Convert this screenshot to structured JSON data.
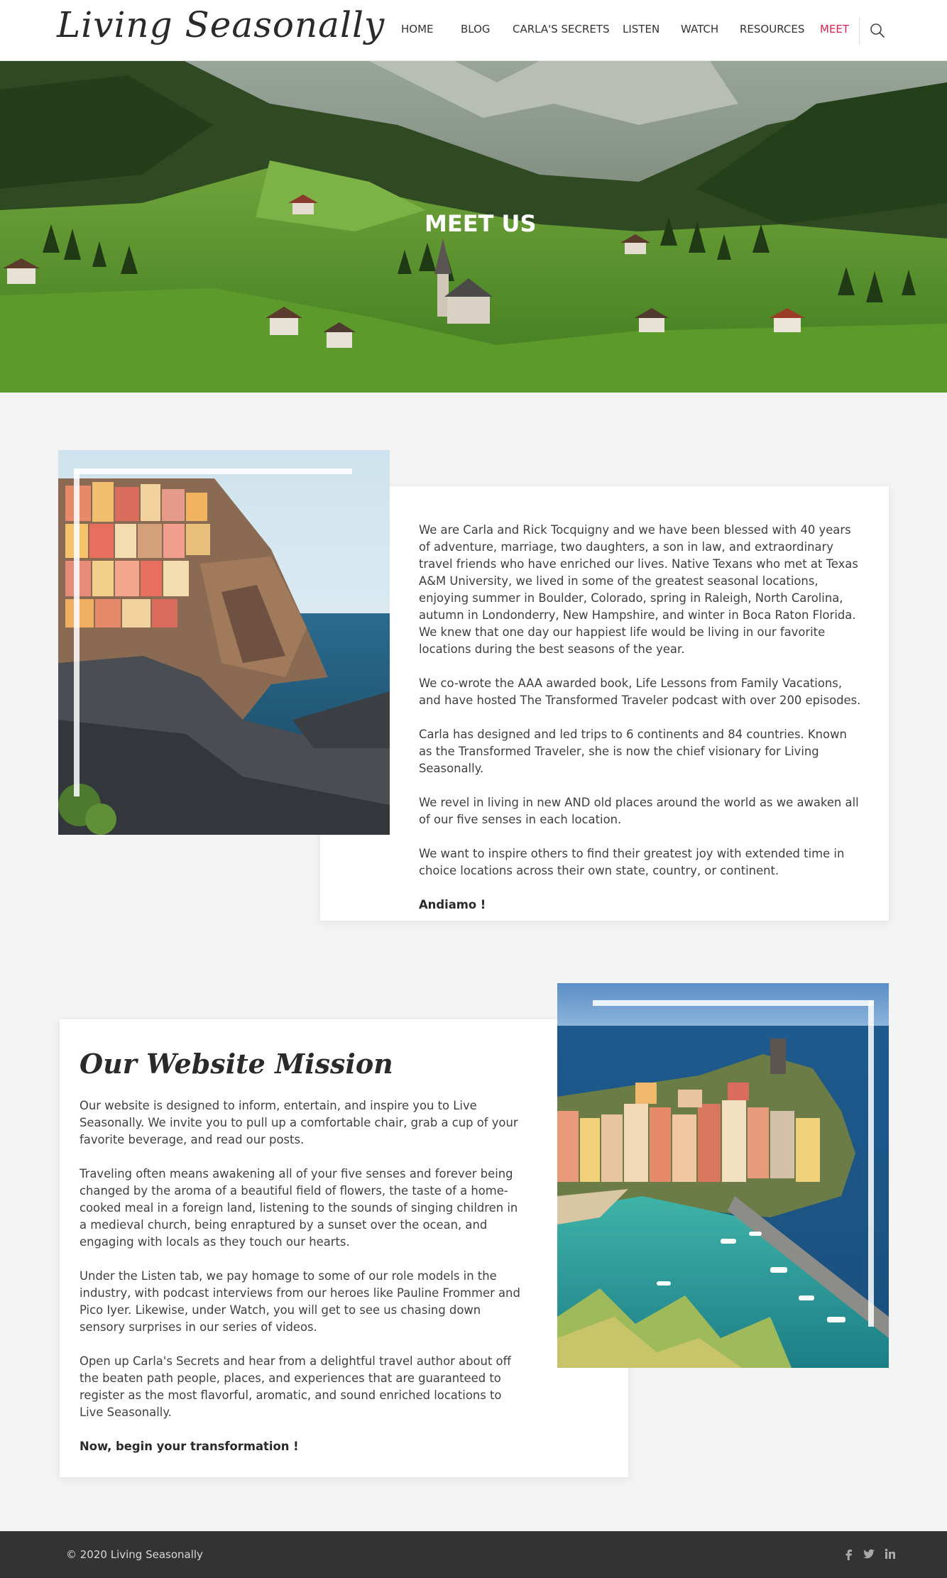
{
  "site": {
    "logo_text": "Living Seasonally"
  },
  "nav": {
    "items": [
      {
        "label": "HOME"
      },
      {
        "label": "BLOG"
      },
      {
        "label": "CARLA'S SECRETS"
      },
      {
        "label": "LISTEN"
      },
      {
        "label": "WATCH"
      },
      {
        "label": "RESOURCES"
      },
      {
        "label": "MEET"
      }
    ],
    "active": "MEET",
    "search_icon": "search-icon"
  },
  "hero": {
    "title": "MEET US"
  },
  "about": {
    "paragraphs": [
      "We are Carla and Rick Tocquigny and we have been blessed with 40 years of adventure, marriage, two daughters, a son in law, and extraordinary travel friends who have enriched our lives. Native Texans who met at Texas A&M University, we lived in some of the greatest seasonal locations, enjoying summer in Boulder, Colorado, spring in Raleigh, North Carolina, autumn in Londonderry, New Hampshire, and winter in Boca Raton Florida. We knew that one day our happiest life would be living in our favorite locations during the best seasons of the year.",
      "We co-wrote the AAA awarded book, Life Lessons from Family Vacations, and have hosted The Transformed Traveler podcast with over 200 episodes.",
      "Carla has designed and led trips to 6 continents and 84 countries. Known as the Transformed Traveler, she is now the chief visionary for Living Seasonally.",
      "We revel in living in new AND old places around the world as we awaken all of our five senses in each location.",
      "We want to inspire others to find their greatest joy with extended time in choice locations across their own state, country, or continent."
    ],
    "closing": "Andiamo !"
  },
  "mission": {
    "title": "Our Website Mission",
    "paragraphs": [
      "Our website is designed to inform, entertain, and inspire you to Live Seasonally. We invite you to pull up a comfortable chair, grab a cup of your favorite beverage, and read our posts.",
      "Traveling often means awakening all of your five senses and forever being changed by the aroma of a beautiful field of flowers, the taste of a home-cooked meal in a foreign land, listening to the sounds of singing children in a medieval church, being enraptured by a sunset over the ocean, and engaging with locals as they touch our hearts.",
      "Under the Listen tab, we pay homage to some of our role models in the industry, with podcast interviews from our heroes like Pauline Frommer and Pico Iyer. Likewise, under Watch, you will get to see us chasing down sensory surprises in our series of videos.",
      "Open up Carla's Secrets and hear from a delightful travel author about off the beaten path people, places, and experiences that are guaranteed to register as the most flavorful, aromatic, and sound enriched locations to Live Seasonally."
    ],
    "closing": "Now, begin your transformation !"
  },
  "footer": {
    "copyright": "© 2020 Living Seasonally",
    "social_icons": [
      "facebook-icon",
      "twitter-icon",
      "linkedin-icon"
    ]
  },
  "colors": {
    "accent": "#d6244f",
    "footer_bg": "#333333",
    "page_bg": "#f3f3f3"
  }
}
